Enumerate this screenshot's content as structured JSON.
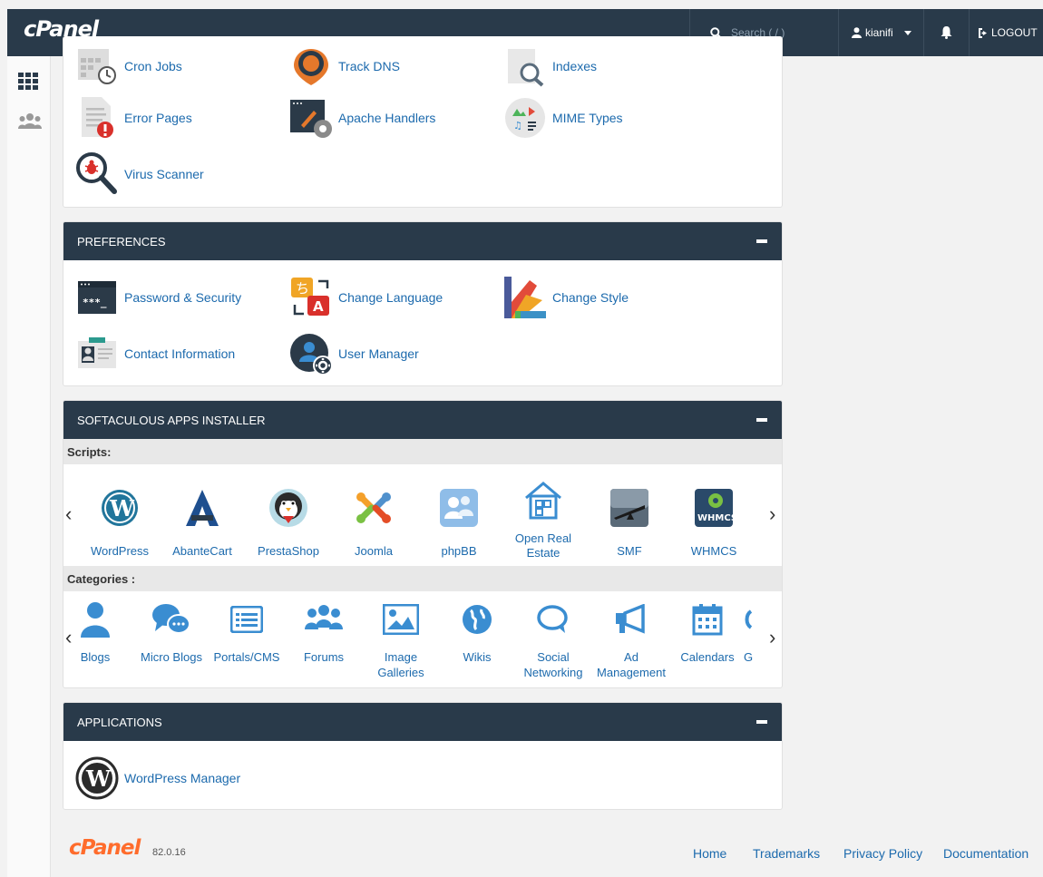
{
  "header": {
    "logo": "cPanel",
    "search_placeholder": "Search ( / )",
    "username": "kianifi",
    "logout_label": "LOGOUT"
  },
  "advanced_panel": {
    "tools": [
      {
        "label": "Cron Jobs",
        "icon": "cron-jobs-icon"
      },
      {
        "label": "Track DNS",
        "icon": "track-dns-icon"
      },
      {
        "label": "Indexes",
        "icon": "indexes-icon"
      },
      {
        "label": "Error Pages",
        "icon": "error-pages-icon"
      },
      {
        "label": "Apache Handlers",
        "icon": "apache-handlers-icon"
      },
      {
        "label": "MIME Types",
        "icon": "mime-types-icon"
      },
      {
        "label": "Virus Scanner",
        "icon": "virus-scanner-icon"
      }
    ]
  },
  "preferences": {
    "title": "PREFERENCES",
    "tools": [
      {
        "label": "Password & Security"
      },
      {
        "label": "Change Language"
      },
      {
        "label": "Change Style"
      },
      {
        "label": "Contact Information"
      },
      {
        "label": "User Manager"
      }
    ]
  },
  "softaculous": {
    "title": "SOFTACULOUS APPS INSTALLER",
    "scripts_label": "Scripts:",
    "categories_label": "Categories :",
    "scripts": [
      "WordPress",
      "AbanteCart",
      "PrestaShop",
      "Joomla",
      "phpBB",
      "Open Real Estate",
      "SMF",
      "WHMCS"
    ],
    "categories": [
      "Blogs",
      "Micro Blogs",
      "Portals/CMS",
      "Forums",
      "Image Galleries",
      "Wikis",
      "Social Networking",
      "Ad Management",
      "Calendars",
      "G"
    ],
    "colors": {
      "accent": "#3a8dd1",
      "wp": "#21759b"
    }
  },
  "applications": {
    "title": "APPLICATIONS",
    "tools": [
      {
        "label": "WordPress Manager"
      }
    ]
  },
  "footer": {
    "logo": "cPanel",
    "version": "82.0.16",
    "links": [
      "Home",
      "Trademarks",
      "Privacy Policy",
      "Documentation"
    ]
  }
}
